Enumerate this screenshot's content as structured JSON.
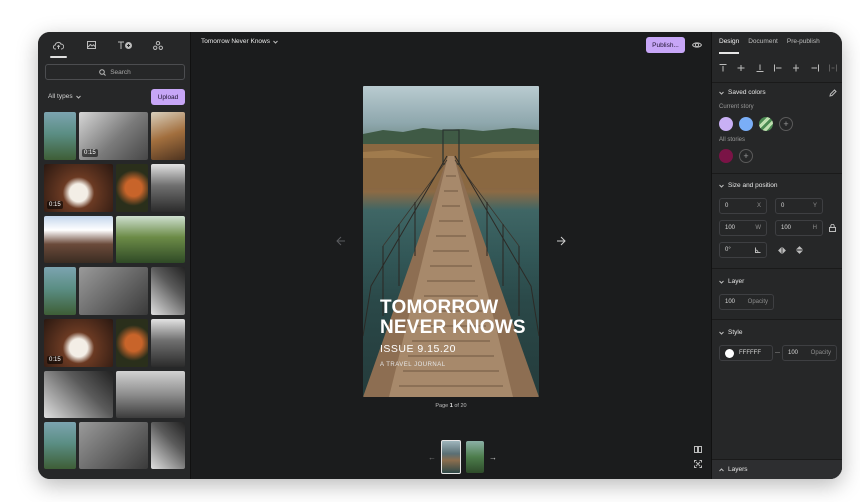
{
  "library": {
    "search_placeholder": "Search",
    "type_filter": "All types",
    "upload_label": "Upload",
    "durations": [
      "0:15",
      "0:15",
      "0:15"
    ]
  },
  "toolbar": {
    "doc_title": "Tomorrow Never Knows",
    "publish_label": "Publish..."
  },
  "canvas": {
    "title_line1": "TOMORROW",
    "title_line2": "NEVER KNOWS",
    "issue": "ISSUE 9.15.20",
    "journal": "A TRAVEL JOURNAL",
    "page_label": "Page",
    "page_current": "1",
    "page_total": "of 20"
  },
  "design": {
    "tabs": [
      "Design",
      "Document",
      "Pre-publish"
    ],
    "saved_colors": {
      "title": "Saved colors",
      "current_story_label": "Current story",
      "current_story_colors": [
        "#c9b0f5",
        "#7aaef7"
      ],
      "all_stories_label": "All stories",
      "all_stories_colors": [
        "#7a1346"
      ]
    },
    "size_position": {
      "title": "Size and position",
      "x": "0",
      "x_unit": "X",
      "y": "0",
      "y_unit": "Y",
      "w": "100",
      "w_unit": "W",
      "h": "100",
      "h_unit": "H",
      "rotation": "0°"
    },
    "layer": {
      "title": "Layer",
      "opacity": "100",
      "opacity_label": "Opacity"
    },
    "style": {
      "title": "Style",
      "color": "FFFFFF",
      "opacity": "100",
      "opacity_label": "Opacity"
    },
    "layers_label": "Layers"
  }
}
